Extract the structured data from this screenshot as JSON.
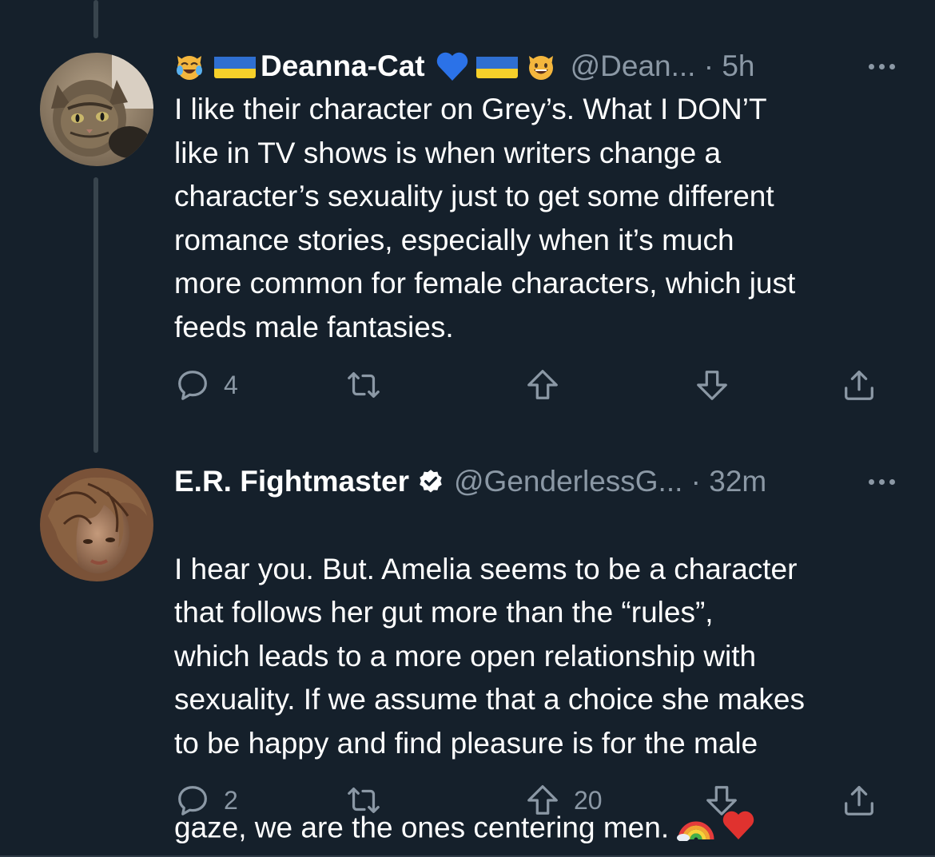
{
  "tweets": [
    {
      "display_name": "Deanna-Cat",
      "handle": "@Dean...",
      "time": "5h",
      "text": "I like their character on Grey’s. What I DON’T\nlike in TV shows is when writers change a\ncharacter’s sexuality just to get some different\nromance stories, especially when it’s much\nmore common for female characters, which just\nfeeds male fantasies.",
      "name_emojis_before": [
        "cat-tears-of-joy-icon",
        "ukraine-flag-icon"
      ],
      "name_emojis_after": [
        "blue-heart-icon",
        "ukraine-flag-icon",
        "smiling-cat-icon"
      ],
      "verified": false,
      "stats": {
        "replies": "4",
        "retweets": "",
        "upvotes": "",
        "downvotes": ""
      }
    },
    {
      "display_name": "E.R. Fightmaster",
      "handle": "@GenderlessG...",
      "time": "32m",
      "text": "I hear you. But. Amelia seems to be a character\nthat follows her gut more than the “rules”,\nwhich leads to a more open relationship with\nsexuality. If we assume that a choice she makes\nto be happy and find pleasure is for the male\ngaze, we are the ones centering men. ",
      "text_emojis": [
        "rainbow-icon",
        "red-heart-icon"
      ],
      "verified": true,
      "stats": {
        "replies": "2",
        "retweets": "",
        "upvotes": "20",
        "downvotes": ""
      }
    }
  ],
  "separator": " · ",
  "colors": {
    "background": "#15202b",
    "text_primary": "#ffffff",
    "text_secondary": "#8b98a5",
    "thread_line": "#38444d"
  }
}
